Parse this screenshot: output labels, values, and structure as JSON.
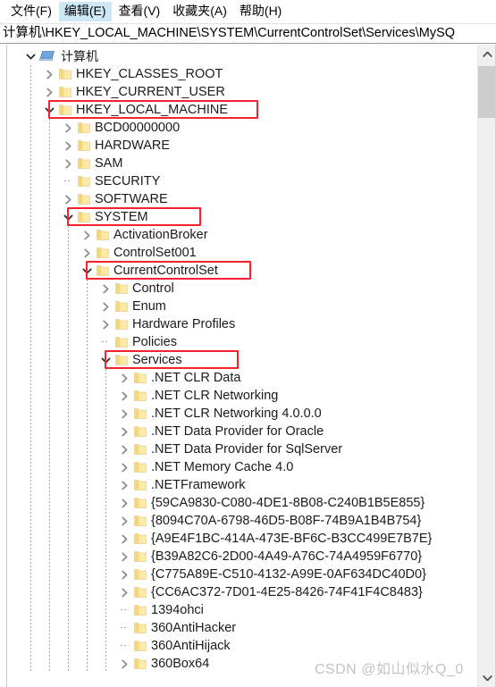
{
  "menu": {
    "items": [
      {
        "label": "文件(F)",
        "hovered": false
      },
      {
        "label": "编辑(E)",
        "hovered": true
      },
      {
        "label": "查看(V)",
        "hovered": false
      },
      {
        "label": "收藏夹(A)",
        "hovered": false
      },
      {
        "label": "帮助(H)",
        "hovered": false
      }
    ]
  },
  "address": {
    "path": "计算机\\HKEY_LOCAL_MACHINE\\SYSTEM\\CurrentControlSet\\Services\\MySQ"
  },
  "tree": {
    "rows": [
      {
        "label": "计算机",
        "depth": 0,
        "icon": "computer",
        "state": "expanded",
        "highlighted": false
      },
      {
        "label": "HKEY_CLASSES_ROOT",
        "depth": 1,
        "icon": "folder",
        "state": "collapsed",
        "highlighted": false
      },
      {
        "label": "HKEY_CURRENT_USER",
        "depth": 1,
        "icon": "folder",
        "state": "collapsed",
        "highlighted": false
      },
      {
        "label": "HKEY_LOCAL_MACHINE",
        "depth": 1,
        "icon": "folder",
        "state": "expanded",
        "highlighted": true
      },
      {
        "label": "BCD00000000",
        "depth": 2,
        "icon": "folder",
        "state": "collapsed",
        "highlighted": false
      },
      {
        "label": "HARDWARE",
        "depth": 2,
        "icon": "folder",
        "state": "collapsed",
        "highlighted": false
      },
      {
        "label": "SAM",
        "depth": 2,
        "icon": "folder",
        "state": "collapsed",
        "highlighted": false
      },
      {
        "label": "SECURITY",
        "depth": 2,
        "icon": "folder",
        "state": "leaf",
        "highlighted": false
      },
      {
        "label": "SOFTWARE",
        "depth": 2,
        "icon": "folder",
        "state": "collapsed",
        "highlighted": false
      },
      {
        "label": "SYSTEM",
        "depth": 2,
        "icon": "folder",
        "state": "expanded",
        "highlighted": true
      },
      {
        "label": "ActivationBroker",
        "depth": 3,
        "icon": "folder",
        "state": "collapsed",
        "highlighted": false
      },
      {
        "label": "ControlSet001",
        "depth": 3,
        "icon": "folder",
        "state": "collapsed",
        "highlighted": false
      },
      {
        "label": "CurrentControlSet",
        "depth": 3,
        "icon": "folder",
        "state": "expanded",
        "highlighted": true
      },
      {
        "label": "Control",
        "depth": 4,
        "icon": "folder",
        "state": "collapsed",
        "highlighted": false
      },
      {
        "label": "Enum",
        "depth": 4,
        "icon": "folder",
        "state": "collapsed",
        "highlighted": false
      },
      {
        "label": "Hardware Profiles",
        "depth": 4,
        "icon": "folder",
        "state": "collapsed",
        "highlighted": false
      },
      {
        "label": "Policies",
        "depth": 4,
        "icon": "folder",
        "state": "leaf",
        "highlighted": false
      },
      {
        "label": "Services",
        "depth": 4,
        "icon": "folder",
        "state": "expanded",
        "highlighted": true
      },
      {
        "label": ".NET CLR Data",
        "depth": 5,
        "icon": "folder",
        "state": "collapsed",
        "highlighted": false
      },
      {
        "label": ".NET CLR Networking",
        "depth": 5,
        "icon": "folder",
        "state": "collapsed",
        "highlighted": false
      },
      {
        "label": ".NET CLR Networking 4.0.0.0",
        "depth": 5,
        "icon": "folder",
        "state": "collapsed",
        "highlighted": false
      },
      {
        "label": ".NET Data Provider for Oracle",
        "depth": 5,
        "icon": "folder",
        "state": "collapsed",
        "highlighted": false
      },
      {
        "label": ".NET Data Provider for SqlServer",
        "depth": 5,
        "icon": "folder",
        "state": "collapsed",
        "highlighted": false
      },
      {
        "label": ".NET Memory Cache 4.0",
        "depth": 5,
        "icon": "folder",
        "state": "collapsed",
        "highlighted": false
      },
      {
        "label": ".NETFramework",
        "depth": 5,
        "icon": "folder",
        "state": "collapsed",
        "highlighted": false
      },
      {
        "label": "{59CA9830-C080-4DE1-8B08-C240B1B5E855}",
        "depth": 5,
        "icon": "folder",
        "state": "collapsed",
        "highlighted": false
      },
      {
        "label": "{8094C70A-6798-46D5-B08F-74B9A1B4B754}",
        "depth": 5,
        "icon": "folder",
        "state": "collapsed",
        "highlighted": false
      },
      {
        "label": "{A9E4F1BC-414A-473E-BF6C-B3CC499E7B7E}",
        "depth": 5,
        "icon": "folder",
        "state": "collapsed",
        "highlighted": false
      },
      {
        "label": "{B39A82C6-2D00-4A49-A76C-74A4959F6770}",
        "depth": 5,
        "icon": "folder",
        "state": "collapsed",
        "highlighted": false
      },
      {
        "label": "{C775A89E-C510-4132-A99E-0AF634DC40D0}",
        "depth": 5,
        "icon": "folder",
        "state": "collapsed",
        "highlighted": false
      },
      {
        "label": "{CC6AC372-7D01-4E25-8426-74F41F4C8483}",
        "depth": 5,
        "icon": "folder",
        "state": "collapsed",
        "highlighted": false
      },
      {
        "label": "1394ohci",
        "depth": 5,
        "icon": "folder",
        "state": "leaf",
        "highlighted": false
      },
      {
        "label": "360AntiHacker",
        "depth": 5,
        "icon": "folder",
        "state": "leaf",
        "highlighted": false
      },
      {
        "label": "360AntiHijack",
        "depth": 5,
        "icon": "folder",
        "state": "leaf",
        "highlighted": false
      },
      {
        "label": "360Box64",
        "depth": 5,
        "icon": "folder",
        "state": "collapsed",
        "highlighted": false
      }
    ]
  },
  "scrollbar": {
    "up_arrow": "scroll-up-arrow",
    "down_arrow": "scroll-down-arrow"
  },
  "watermark": {
    "text": "CSDN @如山似水Q_0"
  },
  "colors": {
    "highlight_box": "#f5222d",
    "menu_hover": "#cfe8f6",
    "folder": "#fde9a9",
    "text": "#1b1b1b"
  }
}
